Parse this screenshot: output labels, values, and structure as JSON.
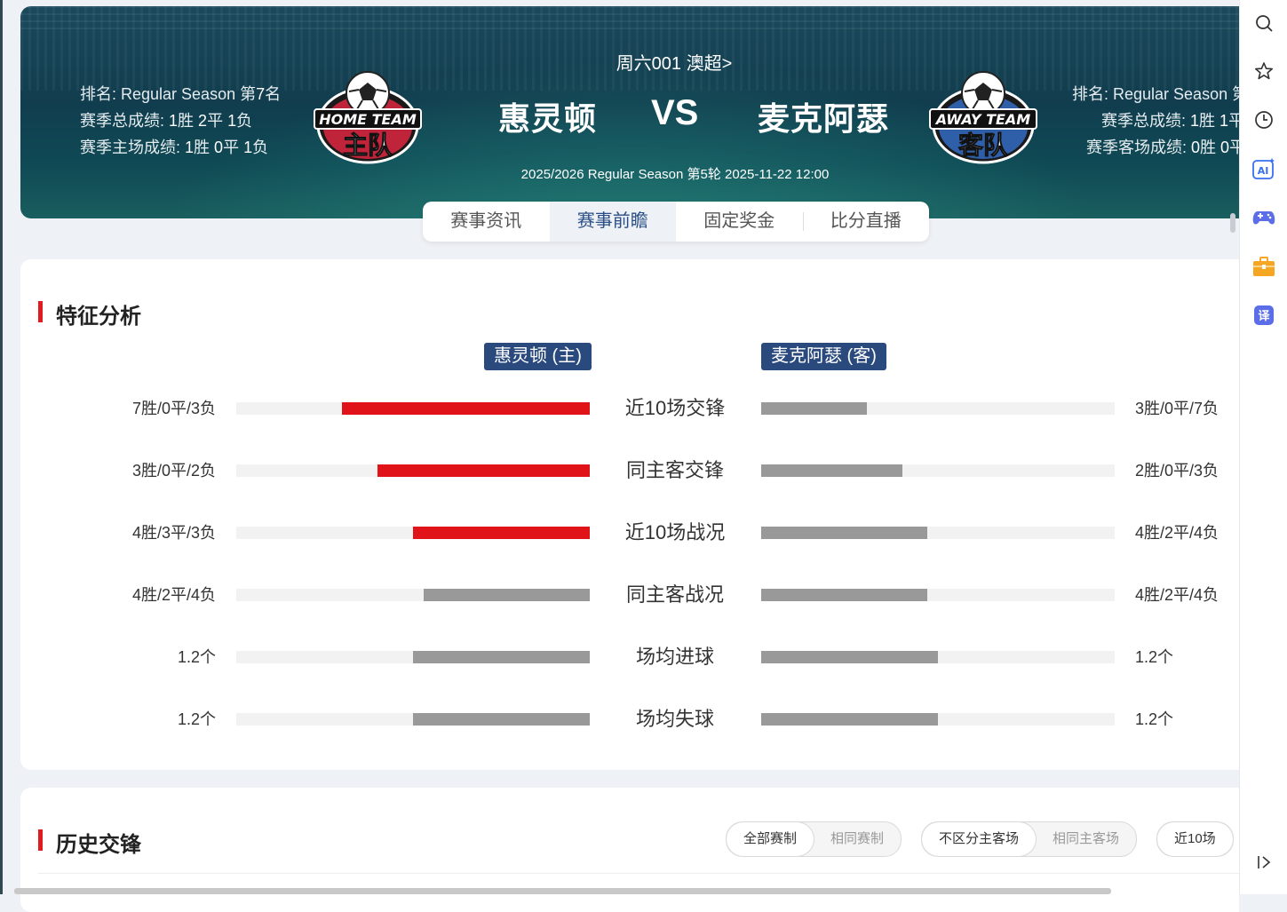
{
  "match": {
    "league": "周六001 澳超>",
    "home_team": "惠灵顿",
    "away_team": "麦克阿瑟",
    "vs": "VS",
    "info": "2025/2026 Regular Season 第5轮 2025-11-22 12:00",
    "home_logo_text": [
      "HOME TEAM",
      "主队"
    ],
    "away_logo_text": [
      "AWAY TEAM",
      "客队"
    ]
  },
  "home_stats": {
    "rank_label": "排名: Regular Season 第",
    "rank_value": "7",
    "rank_suffix": "名",
    "total_label": "赛季总成绩: ",
    "total_w": "1",
    "total_w_unit": "胜 ",
    "total_d": "2",
    "total_d_unit": "平 ",
    "total_l": "1",
    "total_l_unit": "负",
    "venue_label": "赛季主场成绩: ",
    "venue_w": "1",
    "venue_w_unit": "胜 ",
    "venue_d": "0",
    "venue_d_unit": "平 ",
    "venue_l": "1",
    "venue_l_unit": "负"
  },
  "away_stats": {
    "rank_text": "排名: Regular Season 第",
    "total_label": "赛季总成绩: ",
    "total_w": "1",
    "total_w_unit": "胜 ",
    "total_d": "1",
    "total_d_unit": "平",
    "venue_label": "赛季客场成绩: ",
    "venue_w": "0",
    "venue_w_unit": "胜 ",
    "venue_d": "0",
    "venue_d_unit": "平"
  },
  "tabs": [
    "赛事资讯",
    "赛事前瞻",
    "固定奖金",
    "比分直播"
  ],
  "features": {
    "title": "特征分析",
    "home_badge": "惠灵顿 (主)",
    "away_badge": "麦克阿瑟 (客)",
    "rows": [
      {
        "label": "近10场交锋",
        "home": "7胜/0平/3负",
        "away": "3胜/0平/7负",
        "home_ratio": 0.7,
        "away_ratio": 0.3,
        "home_color": "red",
        "away_color": "gray"
      },
      {
        "label": "同主客交锋",
        "home": "3胜/0平/2负",
        "away": "2胜/0平/3负",
        "home_ratio": 0.6,
        "away_ratio": 0.4,
        "home_color": "red",
        "away_color": "gray"
      },
      {
        "label": "近10场战况",
        "home": "4胜/3平/3负",
        "away": "4胜/2平/4负",
        "home_ratio": 0.5,
        "away_ratio": 0.47,
        "home_color": "red",
        "away_color": "gray"
      },
      {
        "label": "同主客战况",
        "home": "4胜/2平/4负",
        "away": "4胜/2平/4负",
        "home_ratio": 0.47,
        "away_ratio": 0.47,
        "home_color": "gray",
        "away_color": "gray"
      },
      {
        "label": "场均进球",
        "home": "1.2个",
        "away": "1.2个",
        "home_ratio": 0.5,
        "away_ratio": 0.5,
        "home_color": "gray",
        "away_color": "gray"
      },
      {
        "label": "场均失球",
        "home": "1.2个",
        "away": "1.2个",
        "home_ratio": 0.5,
        "away_ratio": 0.5,
        "home_color": "gray",
        "away_color": "gray"
      }
    ]
  },
  "history": {
    "title": "历史交锋",
    "filter_competition": [
      "全部赛制",
      "相同赛制"
    ],
    "filter_venue": [
      "不区分主客场",
      "相同主客场"
    ],
    "filter_count": [
      "近10场"
    ]
  },
  "toolbar": [
    "search-icon",
    "star-icon",
    "history-icon",
    "ai-icon",
    "game-icon",
    "briefcase-icon",
    "translate-icon",
    "collapse-icon"
  ],
  "toolbar_text": {
    "ai": "AI",
    "translate": "译"
  },
  "colors": {
    "red": "#e01418",
    "gray": "#999999",
    "navy": "#2a4a7e",
    "accent_bar": "#e11c20"
  }
}
